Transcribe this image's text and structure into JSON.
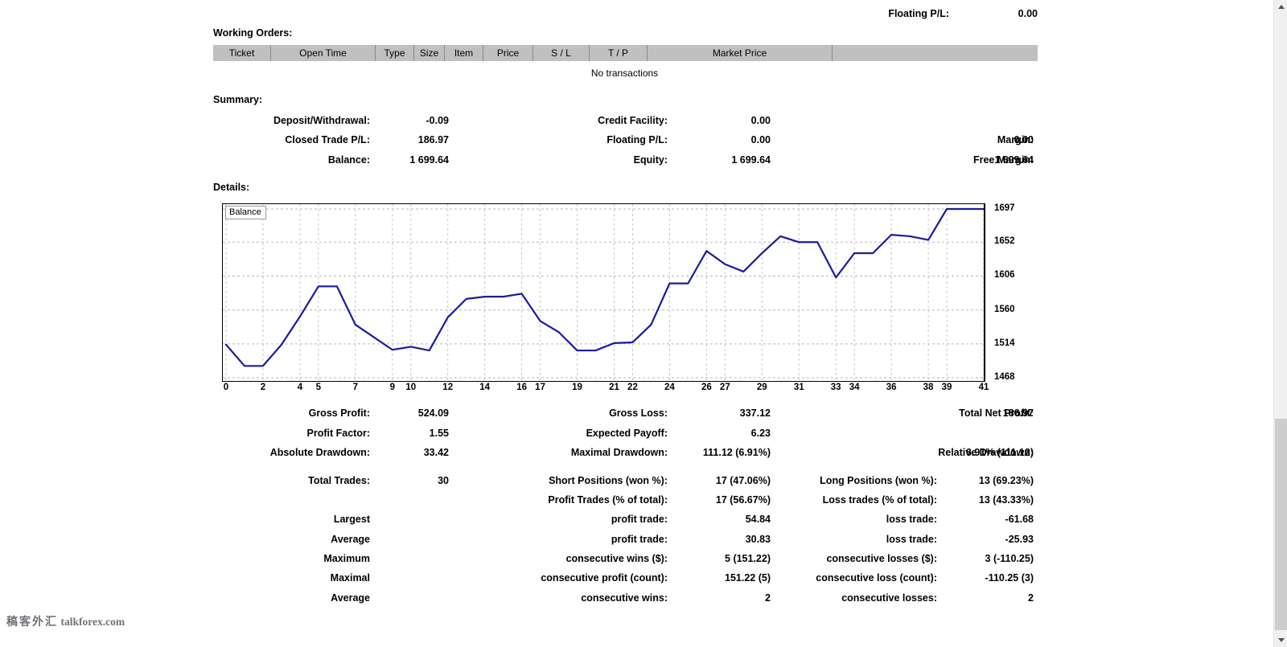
{
  "header": {
    "floating_pl_label": "Floating P/L:",
    "floating_pl_value": "0.00"
  },
  "working_orders": {
    "title": "Working Orders:",
    "columns": [
      "Ticket",
      "Open Time",
      "Type",
      "Size",
      "Item",
      "Price",
      "S / L",
      "T / P",
      "Market Price",
      ""
    ],
    "empty_message": "No transactions"
  },
  "summary": {
    "title": "Summary:",
    "rows": [
      {
        "c1_label": "Deposit/Withdrawal:",
        "c1_value": "-0.09",
        "c2_label": "Credit Facility:",
        "c2_value": "0.00",
        "c3_label": "",
        "c3_value": ""
      },
      {
        "c1_label": "Closed Trade P/L:",
        "c1_value": "186.97",
        "c2_label": "Floating P/L:",
        "c2_value": "0.00",
        "c3_label": "Margin:",
        "c3_value": "0.00"
      },
      {
        "c1_label": "Balance:",
        "c1_value": "1 699.64",
        "c2_label": "Equity:",
        "c2_value": "1 699.64",
        "c3_label": "Free Margin:",
        "c3_value": "1 699.64"
      }
    ]
  },
  "details": {
    "title": "Details:"
  },
  "chart_data": {
    "type": "line",
    "title": "Balance",
    "legend_label": "Balance",
    "legend_position": "top-left",
    "xlabel": "",
    "ylabel": "",
    "grid": true,
    "line_color": "#1b1b9e",
    "xlim": [
      0,
      41
    ],
    "ylim": [
      1468,
      1697
    ],
    "yticks": [
      1697,
      1652,
      1606,
      1560,
      1514,
      1468
    ],
    "xticks": [
      0,
      2,
      4,
      5,
      7,
      9,
      10,
      12,
      14,
      16,
      17,
      19,
      21,
      22,
      24,
      26,
      27,
      29,
      31,
      33,
      34,
      36,
      38,
      39,
      41
    ],
    "x": [
      0,
      1,
      2,
      3,
      4,
      5,
      6,
      7,
      8,
      9,
      10,
      11,
      12,
      13,
      14,
      15,
      16,
      17,
      18,
      19,
      20,
      21,
      22,
      23,
      24,
      25,
      26,
      27,
      28,
      29,
      30,
      31,
      32,
      33,
      34,
      35,
      36,
      37,
      38,
      39,
      40,
      41
    ],
    "values": [
      1513,
      1484,
      1484,
      1513,
      1551,
      1592,
      1592,
      1540,
      1523,
      1506,
      1510,
      1505,
      1550,
      1575,
      1578,
      1578,
      1582,
      1545,
      1530,
      1505,
      1505,
      1515,
      1516,
      1540,
      1596,
      1596,
      1640,
      1622,
      1612,
      1637,
      1660,
      1652,
      1652,
      1604,
      1637,
      1637,
      1662,
      1660,
      1655,
      1697,
      1697,
      1697
    ],
    "series": [
      {
        "name": "Balance",
        "values": [
          1513,
          1484,
          1484,
          1513,
          1551,
          1592,
          1592,
          1540,
          1523,
          1506,
          1510,
          1505,
          1550,
          1575,
          1578,
          1578,
          1582,
          1545,
          1530,
          1505,
          1505,
          1515,
          1516,
          1540,
          1596,
          1596,
          1640,
          1622,
          1612,
          1637,
          1660,
          1652,
          1652,
          1604,
          1637,
          1637,
          1662,
          1660,
          1655,
          1697,
          1697,
          1697
        ]
      }
    ]
  },
  "stats": {
    "rows": [
      {
        "c1_label": "Gross Profit:",
        "c1_value": "524.09",
        "c2_label": "Gross Loss:",
        "c2_value": "337.12",
        "c3_label": "Total Net Profit:",
        "c3_value": "186.97"
      },
      {
        "c1_label": "Profit Factor:",
        "c1_value": "1.55",
        "c2_label": "Expected Payoff:",
        "c2_value": "6.23",
        "c3_label": "",
        "c3_value": ""
      },
      {
        "c1_label": "Absolute Drawdown:",
        "c1_value": "33.42",
        "c2_label": "Maximal Drawdown:",
        "c2_value": "111.12 (6.91%)",
        "c3_label": "Relative Drawdown:",
        "c3_value": "6.91% (111.12)"
      }
    ],
    "trade_rows": [
      {
        "c1_label": "Total Trades:",
        "c1_value": "30",
        "c2_label": "Short Positions (won %):",
        "c2_value": "17 (47.06%)",
        "c3_label": "Long Positions (won %):",
        "c3_value": "13 (69.23%)"
      },
      {
        "c1_label": "",
        "c1_value": "",
        "c2_label": "Profit Trades (% of total):",
        "c2_value": "17 (56.67%)",
        "c3_label": "Loss trades (% of total):",
        "c3_value": "13 (43.33%)"
      },
      {
        "c1_label": "Largest",
        "c1_value": "",
        "c2_label": "profit trade:",
        "c2_value": "54.84",
        "c3_label": "loss trade:",
        "c3_value": "-61.68"
      },
      {
        "c1_label": "Average",
        "c1_value": "",
        "c2_label": "profit trade:",
        "c2_value": "30.83",
        "c3_label": "loss trade:",
        "c3_value": "-25.93"
      },
      {
        "c1_label": "Maximum",
        "c1_value": "",
        "c2_label": "consecutive wins ($):",
        "c2_value": "5 (151.22)",
        "c3_label": "consecutive losses ($):",
        "c3_value": "3 (-110.25)"
      },
      {
        "c1_label": "Maximal",
        "c1_value": "",
        "c2_label": "consecutive profit (count):",
        "c2_value": "151.22 (5)",
        "c3_label": "consecutive loss (count):",
        "c3_value": "-110.25 (3)"
      },
      {
        "c1_label": "Average",
        "c1_value": "",
        "c2_label": "consecutive wins:",
        "c2_value": "2",
        "c3_label": "consecutive losses:",
        "c3_value": "2"
      }
    ]
  },
  "watermark": {
    "cn": "稿客外汇",
    "en": "talkforex.com"
  },
  "scrollbar": {
    "up_arrow": "scroll-up",
    "down_arrow": "scroll-down"
  }
}
